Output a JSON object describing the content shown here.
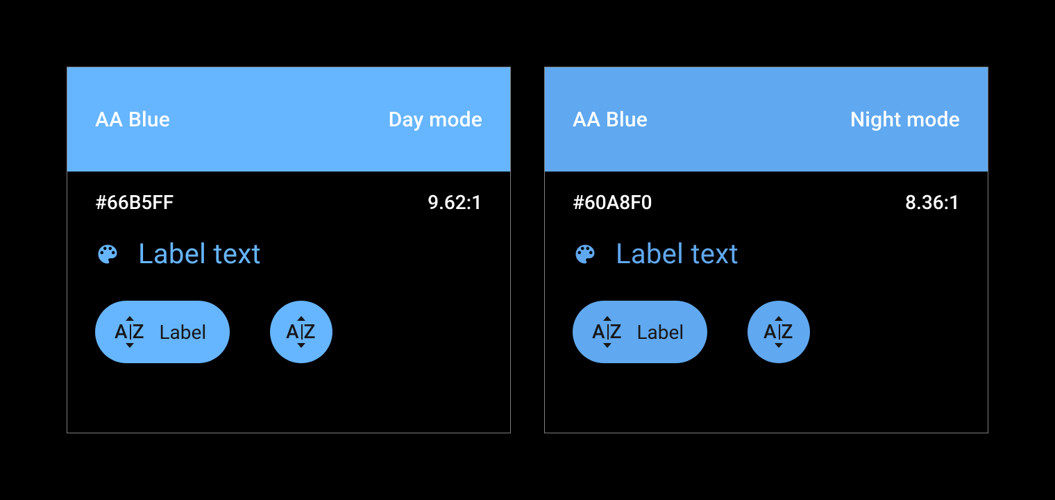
{
  "cards": [
    {
      "title": "AA Blue",
      "mode": "Day mode",
      "hex": "#66B5FF",
      "ratio": "9.62:1",
      "accent": "#66B5FF",
      "labelText": "Label text",
      "chipLabel": "Label"
    },
    {
      "title": "AA Blue",
      "mode": "Night mode",
      "hex": "#60A8F0",
      "ratio": "8.36:1",
      "accent": "#60A8F0",
      "labelText": "Label text",
      "chipLabel": "Label"
    }
  ]
}
